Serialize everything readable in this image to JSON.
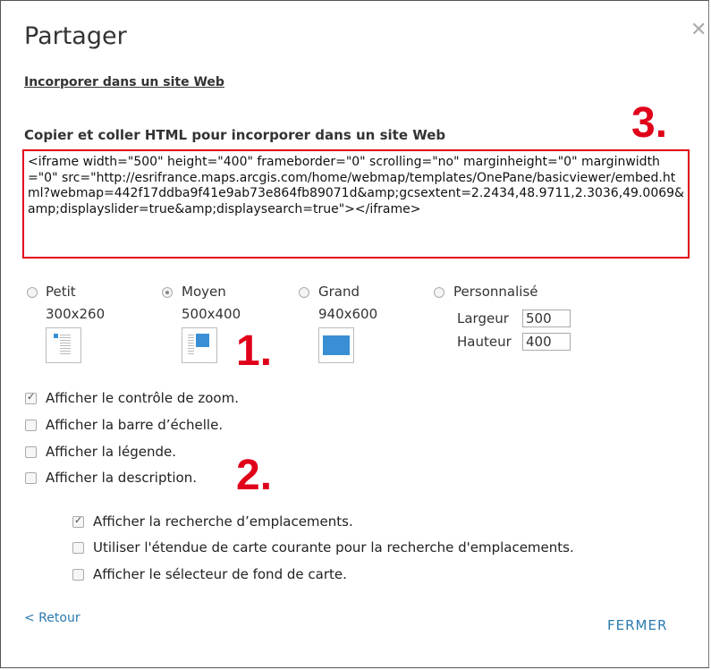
{
  "dialog": {
    "title": "Partager",
    "section_link": "Incorporer dans un site Web",
    "copy_label": "Copier et coller HTML pour incorporer dans un site Web",
    "embed_code": "<iframe width=\"500\" height=\"400\" frameborder=\"0\" scrolling=\"no\" marginheight=\"0\" marginwidth=\"0\" src=\"http://esrifrance.maps.arcgis.com/home/webmap/templates/OnePane/basicviewer/embed.html?webmap=442f17ddba9f41e9ab73e864fb89071d&amp;gcsextent=2.2434,48.9711,2.3036,49.0069&amp;displayslider=true&amp;displaysearch=true\"></iframe>"
  },
  "annotations": {
    "one": "1.",
    "two": "2.",
    "three": "3."
  },
  "sizes": [
    {
      "label": "Petit",
      "dims": "300x260",
      "selected": false
    },
    {
      "label": "Moyen",
      "dims": "500x400",
      "selected": true
    },
    {
      "label": "Grand",
      "dims": "940x600",
      "selected": false
    },
    {
      "label": "Personnalisé",
      "selected": false
    }
  ],
  "custom": {
    "width_label": "Largeur",
    "width_value": "500",
    "height_label": "Hauteur",
    "height_value": "400"
  },
  "options": [
    {
      "label": "Afficher le contrôle de zoom.",
      "checked": true
    },
    {
      "label": "Afficher la barre d’échelle.",
      "checked": false
    },
    {
      "label": "Afficher la légende.",
      "checked": false
    },
    {
      "label": "Afficher la description.",
      "checked": false
    }
  ],
  "search_options": [
    {
      "label": "Afficher la recherche d’emplacements.",
      "checked": true
    },
    {
      "label": "Utiliser l'étendue de carte courante pour la recherche d'emplacements.",
      "checked": false
    },
    {
      "label": "Afficher le sélecteur de fond de carte.",
      "checked": false
    }
  ],
  "footer": {
    "back": "< Retour",
    "close": "FERMER"
  },
  "colors": {
    "accent": "#2a7ab0",
    "marker": "#e0001a",
    "thumb_fill": "#3a8fd4"
  }
}
